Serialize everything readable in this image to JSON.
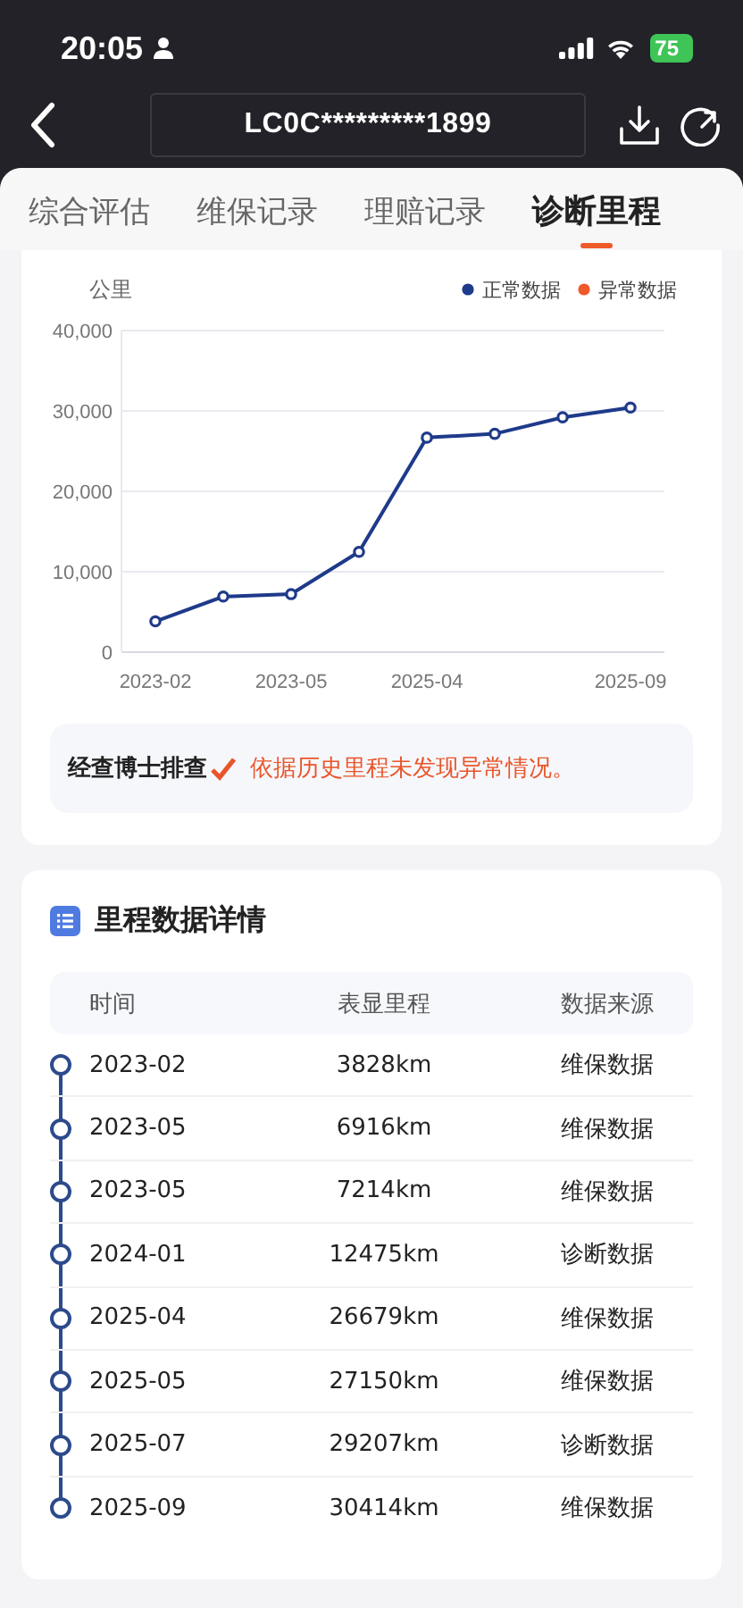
{
  "status_bar": {
    "time": "20:05",
    "battery": "75"
  },
  "nav": {
    "title": "LC0C*********1899"
  },
  "tabs": [
    {
      "label": "综合评估",
      "selected": false
    },
    {
      "label": "维保记录",
      "selected": false
    },
    {
      "label": "理赔记录",
      "selected": false
    },
    {
      "label": "诊断里程",
      "selected": true
    }
  ],
  "mileage_chart": {
    "chart_data": {
      "type": "line",
      "ylabel": "公里",
      "categories": [
        "2023-02",
        null,
        "2023-05",
        null,
        "2025-04",
        null,
        null,
        "2025-09"
      ],
      "grid": true,
      "ylim": [
        0,
        40000
      ],
      "yticks": [
        {
          "value": 0,
          "label": "0"
        },
        {
          "value": 10000,
          "label": "10,000"
        },
        {
          "value": 20000,
          "label": "20,000"
        },
        {
          "value": 30000,
          "label": "30,000"
        },
        {
          "value": 40000,
          "label": "40,000"
        }
      ],
      "series": [
        {
          "name": "正常数据",
          "color": "#1e3a8a",
          "marker": "circle",
          "values": [
            3828,
            6916,
            7214,
            12475,
            26679,
            27150,
            29207,
            30414
          ]
        },
        {
          "name": "异常数据",
          "color": "#ee5a2a",
          "values": [
            null,
            null,
            null,
            null,
            null,
            null,
            null,
            null
          ]
        }
      ]
    }
  },
  "conclusion": {
    "label": "经查博士排查",
    "text": "依据历史里程未发现异常情况。"
  },
  "details": {
    "title": "里程数据详情",
    "columns": [
      "时间",
      "表显里程",
      "数据来源"
    ],
    "rows": [
      [
        "2023-02",
        "3828km",
        "维保数据"
      ],
      [
        "2023-05",
        "6916km",
        "维保数据"
      ],
      [
        "2023-05",
        "7214km",
        "维保数据"
      ],
      [
        "2024-01",
        "12475km",
        "诊断数据"
      ],
      [
        "2025-04",
        "26679km",
        "维保数据"
      ],
      [
        "2025-05",
        "27150km",
        "维保数据"
      ],
      [
        "2025-07",
        "29207km",
        "诊断数据"
      ],
      [
        "2025-09",
        "30414km",
        "维保数据"
      ]
    ]
  }
}
